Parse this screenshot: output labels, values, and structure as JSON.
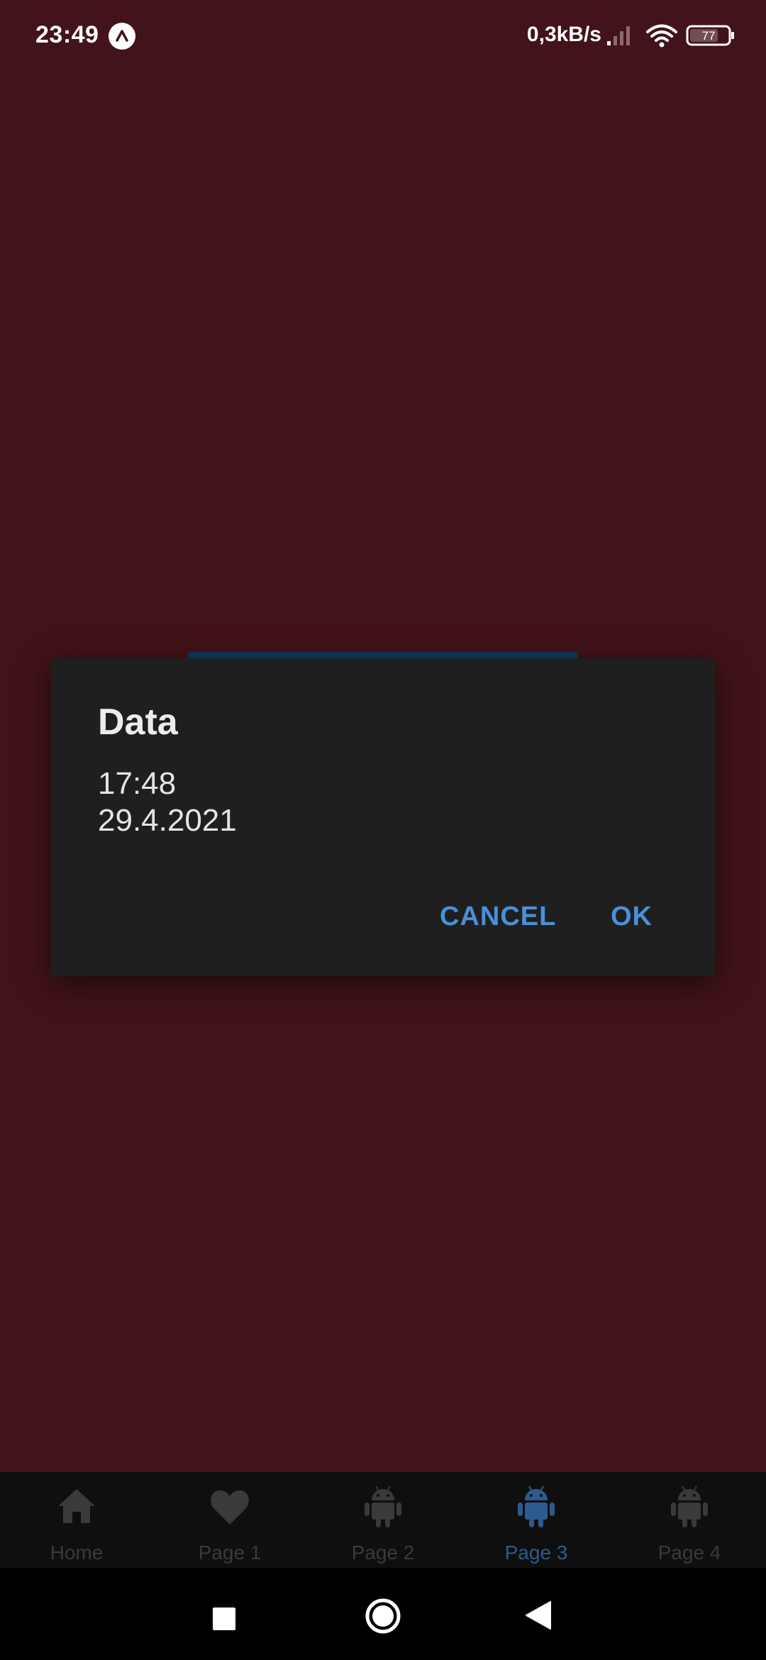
{
  "status_bar": {
    "time": "23:49",
    "net_speed": "0,3kB/s",
    "battery_level": "77",
    "icons": [
      "app-notification-icon",
      "signal-icon",
      "wifi-icon",
      "battery-icon"
    ]
  },
  "dialog": {
    "title": "Data",
    "line1": "17:48",
    "line2": "29.4.2021",
    "cancel_label": "CANCEL",
    "ok_label": "OK"
  },
  "bottom_nav": {
    "active_index": 3,
    "items": [
      {
        "label": "Home",
        "icon": "home-icon"
      },
      {
        "label": "Page 1",
        "icon": "heart-icon"
      },
      {
        "label": "Page 2",
        "icon": "android-icon"
      },
      {
        "label": "Page 3",
        "icon": "android-icon"
      },
      {
        "label": "Page 4",
        "icon": "android-icon"
      }
    ]
  },
  "system_nav": {
    "buttons": [
      "recents-button",
      "home-button",
      "back-button"
    ]
  },
  "colors": {
    "background": "#421318",
    "dialog": "#1f1f1f",
    "accent": "#4a90d9",
    "nav_active": "#2c5b8f",
    "nav_inactive": "#3a3a3a"
  }
}
